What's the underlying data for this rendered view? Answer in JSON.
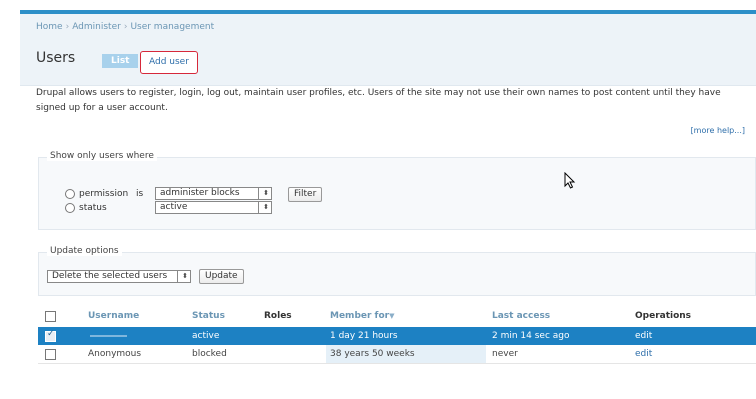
{
  "breadcrumb": [
    "Home",
    "Administer",
    "User management"
  ],
  "page_title": "Users",
  "tabs": {
    "list": "List",
    "add_user": "Add user"
  },
  "description": "Drupal allows users to register, login, log out, maintain user profiles, etc. Users of the site may not use their own names to post content until they have signed up for a user account.",
  "more_help": "[more help...]",
  "filter": {
    "legend": "Show only users where",
    "conditions": [
      {
        "label": "permission",
        "operator": "is",
        "value": "administer blocks"
      },
      {
        "label": "status",
        "value": "active"
      }
    ],
    "button": "Filter"
  },
  "update": {
    "legend": "Update options",
    "selected": "Delete the selected users",
    "button": "Update"
  },
  "table": {
    "headers": [
      "Username",
      "Status",
      "Roles",
      "Member for",
      "Last access",
      "Operations"
    ],
    "sort_column": "Member for",
    "rows": [
      {
        "username": "",
        "status": "active",
        "roles": "",
        "member_for": "1 day 21 hours",
        "last_access": "2 min 14 sec ago",
        "operation": "edit",
        "selected": true
      },
      {
        "username": "Anonymous",
        "status": "blocked",
        "roles": "",
        "member_for": "38 years 50 weeks",
        "last_access": "never",
        "operation": "edit",
        "selected": false
      }
    ]
  },
  "colors": {
    "accent": "#1d81c3",
    "link": "#2f6faa",
    "highlight_border": "#d6283a"
  }
}
